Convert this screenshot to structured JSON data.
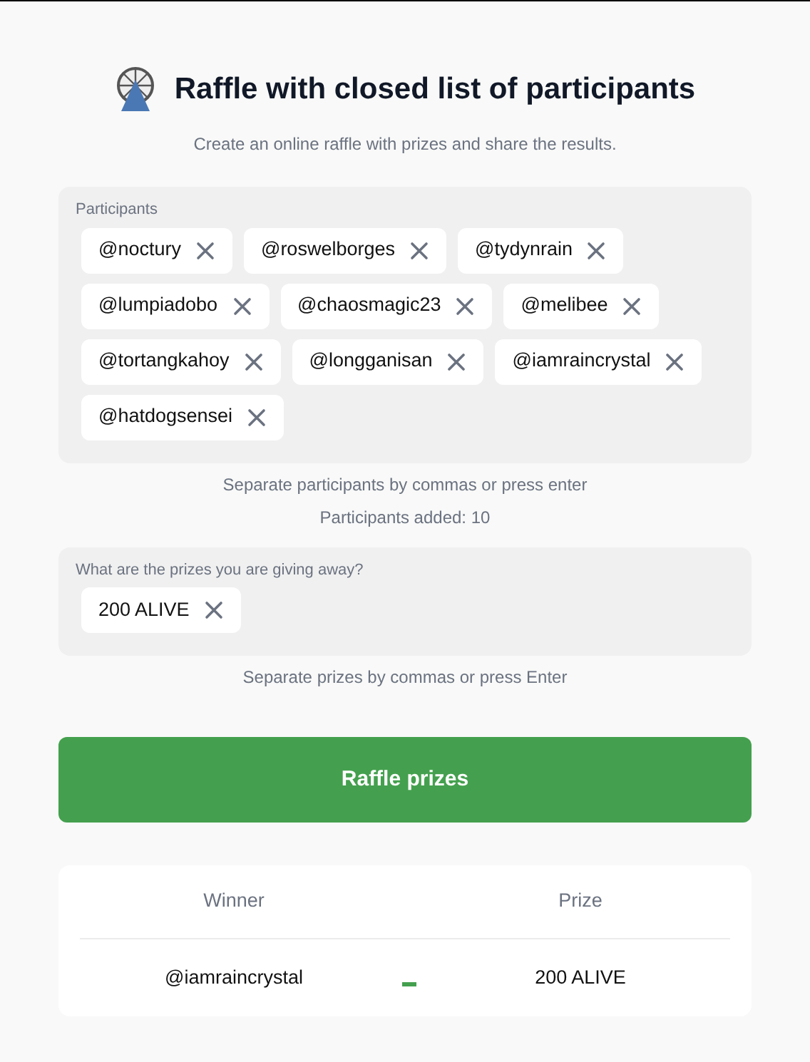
{
  "title": "Raffle with closed list of participants",
  "subtitle": "Create an online raffle with prizes and share the results.",
  "participants": {
    "label": "Participants",
    "chips": [
      "@noctury",
      "@roswelborges",
      "@tydynrain",
      "@lumpiadobo",
      "@chaosmagic23",
      "@melibee",
      "@tortangkahoy",
      "@longganisan",
      "@iamraincrystal",
      "@hatdogsensei"
    ],
    "hint": "Separate participants by commas or press enter",
    "count": "Participants added: 10"
  },
  "prizes": {
    "label": "What are the prizes you are giving away?",
    "chips": [
      "200 ALIVE"
    ],
    "hint": "Separate prizes by commas or press Enter"
  },
  "button": "Raffle prizes",
  "results": {
    "columns": [
      "Winner",
      "Prize"
    ],
    "rows": [
      {
        "winner": "@iamraincrystal",
        "prize": "200 ALIVE"
      }
    ]
  }
}
